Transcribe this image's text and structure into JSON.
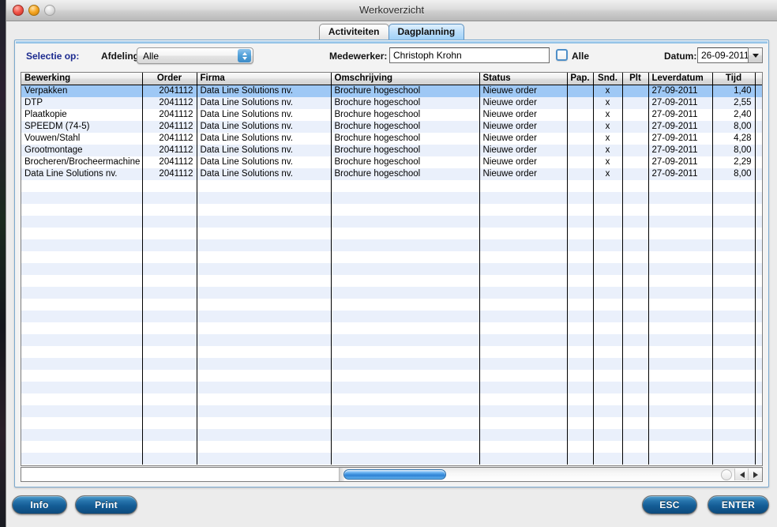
{
  "window": {
    "title": "Werkoverzicht",
    "traffic_lights": [
      "close-light",
      "minimize-light",
      "zoom-light"
    ]
  },
  "tabs": [
    {
      "label": "Activiteiten",
      "active": false
    },
    {
      "label": "Dagplanning",
      "active": true
    }
  ],
  "filter_bar": {
    "selectie_label": "Selectie op:",
    "afdeling_label": "Afdeling:",
    "afdeling_value": "Alle",
    "medewerker_label": "Medewerker:",
    "medewerker_value": "Christoph Krohn",
    "alle_checkbox_label": "Alle",
    "alle_checkbox_checked": false,
    "datum_label": "Datum:",
    "datum_value": "26-09-2011"
  },
  "table": {
    "columns": [
      {
        "key": "bewerking",
        "label": "Bewerking",
        "align": "left"
      },
      {
        "key": "order",
        "label": "Order",
        "align": "right"
      },
      {
        "key": "firma",
        "label": "Firma",
        "align": "left"
      },
      {
        "key": "omschrijving",
        "label": "Omschrijving",
        "align": "left"
      },
      {
        "key": "status",
        "label": "Status",
        "align": "left"
      },
      {
        "key": "pap",
        "label": "Pap.",
        "align": "center"
      },
      {
        "key": "snd",
        "label": "Snd.",
        "align": "center"
      },
      {
        "key": "plt",
        "label": "Plt",
        "align": "center"
      },
      {
        "key": "leverdatum",
        "label": "Leverdatum",
        "align": "left"
      },
      {
        "key": "tijd",
        "label": "Tijd",
        "align": "right"
      },
      {
        "key": "spare",
        "label": "",
        "align": "left"
      }
    ],
    "rows": [
      {
        "bewerking": "Verpakken",
        "order": "2041112",
        "firma": "Data Line Solutions nv.",
        "omschrijving": "Brochure hogeschool",
        "status": "Nieuwe order",
        "pap": "",
        "snd": "x",
        "plt": "",
        "leverdatum": "27-09-2011",
        "tijd": "1,40",
        "spare": "",
        "selected": true
      },
      {
        "bewerking": "DTP",
        "order": "2041112",
        "firma": "Data Line Solutions nv.",
        "omschrijving": "Brochure hogeschool",
        "status": "Nieuwe order",
        "pap": "",
        "snd": "x",
        "plt": "",
        "leverdatum": "27-09-2011",
        "tijd": "2,55",
        "spare": "",
        "selected": false
      },
      {
        "bewerking": "Plaatkopie",
        "order": "2041112",
        "firma": "Data Line Solutions nv.",
        "omschrijving": "Brochure hogeschool",
        "status": "Nieuwe order",
        "pap": "",
        "snd": "x",
        "plt": "",
        "leverdatum": "27-09-2011",
        "tijd": "2,40",
        "spare": "",
        "selected": false
      },
      {
        "bewerking": "SPEEDM (74-5)",
        "order": "2041112",
        "firma": "Data Line Solutions nv.",
        "omschrijving": "Brochure hogeschool",
        "status": "Nieuwe order",
        "pap": "",
        "snd": "x",
        "plt": "",
        "leverdatum": "27-09-2011",
        "tijd": "8,00",
        "spare": "",
        "selected": false
      },
      {
        "bewerking": "Vouwen/Stahl",
        "order": "2041112",
        "firma": "Data Line Solutions nv.",
        "omschrijving": "Brochure hogeschool",
        "status": "Nieuwe order",
        "pap": "",
        "snd": "x",
        "plt": "",
        "leverdatum": "27-09-2011",
        "tijd": "4,28",
        "spare": "",
        "selected": false
      },
      {
        "bewerking": "Grootmontage",
        "order": "2041112",
        "firma": "Data Line Solutions nv.",
        "omschrijving": "Brochure hogeschool",
        "status": "Nieuwe order",
        "pap": "",
        "snd": "x",
        "plt": "",
        "leverdatum": "27-09-2011",
        "tijd": "8,00",
        "spare": "",
        "selected": false
      },
      {
        "bewerking": "Brocheren/Brocheermachine",
        "order": "2041112",
        "firma": "Data Line Solutions nv.",
        "omschrijving": "Brochure hogeschool",
        "status": "Nieuwe order",
        "pap": "",
        "snd": "x",
        "plt": "",
        "leverdatum": "27-09-2011",
        "tijd": "2,29",
        "spare": "",
        "selected": false
      },
      {
        "bewerking": "Data Line Solutions nv.",
        "order": "2041112",
        "firma": "Data Line Solutions nv.",
        "omschrijving": "Brochure hogeschool",
        "status": "Nieuwe order",
        "pap": "",
        "snd": "x",
        "plt": "",
        "leverdatum": "27-09-2011",
        "tijd": "8,00",
        "spare": "",
        "selected": false
      }
    ],
    "empty_row_count": 24
  },
  "scrollbar": {
    "orientation": "horizontal",
    "left_arrow": "scroll-left-arrow",
    "right_arrow": "scroll-right-arrow"
  },
  "buttons": {
    "info": "Info",
    "print": "Print",
    "esc": "ESC",
    "enter": "ENTER"
  },
  "colors": {
    "accent_blue": "#1b2a8f",
    "selection_blue": "#9ec8f5",
    "stripe_blue": "#eaf0fb",
    "button_blue": "#145d96",
    "panel_border": "#7aa9cf"
  }
}
